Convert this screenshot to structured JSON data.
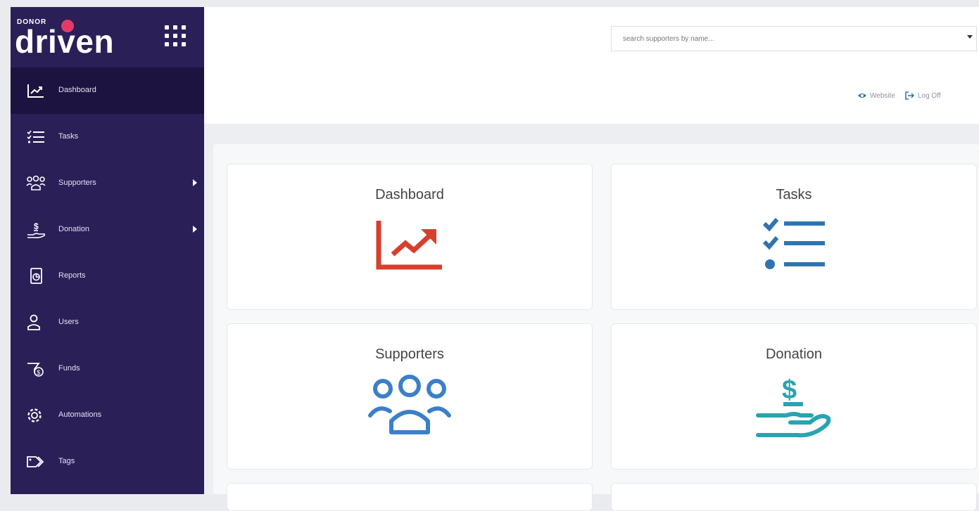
{
  "brand": {
    "small": "DONOR",
    "big": "driven"
  },
  "sidebar": {
    "items": [
      {
        "label": "Dashboard",
        "icon": "dashboard-icon",
        "active": true,
        "submenu": false
      },
      {
        "label": "Tasks",
        "icon": "tasks-icon",
        "active": false,
        "submenu": false
      },
      {
        "label": "Supporters",
        "icon": "supporters-icon",
        "active": false,
        "submenu": true
      },
      {
        "label": "Donation",
        "icon": "donation-icon",
        "active": false,
        "submenu": true
      },
      {
        "label": "Reports",
        "icon": "reports-icon",
        "active": false,
        "submenu": false
      },
      {
        "label": "Users",
        "icon": "users-icon",
        "active": false,
        "submenu": false
      },
      {
        "label": "Funds",
        "icon": "funds-icon",
        "active": false,
        "submenu": false
      },
      {
        "label": "Automations",
        "icon": "automations-icon",
        "active": false,
        "submenu": false
      },
      {
        "label": "Tags",
        "icon": "tags-icon",
        "active": false,
        "submenu": false
      }
    ]
  },
  "header": {
    "search_placeholder": "search supporters by name...",
    "website_label": "Website",
    "logoff_label": "Log Off"
  },
  "cards": [
    {
      "title": "Dashboard",
      "icon": "trend-chart-icon",
      "color": "#d6402d"
    },
    {
      "title": "Tasks",
      "icon": "checklist-icon",
      "color": "#2f74b1"
    },
    {
      "title": "Supporters",
      "icon": "people-group-icon",
      "color": "#3a7fcb"
    },
    {
      "title": "Donation",
      "icon": "hand-dollar-icon",
      "color": "#2aa3b0"
    }
  ],
  "colors": {
    "sidebar": "#2b1f57",
    "sidebar_active": "#1c1340",
    "accent": "#e23c66"
  }
}
